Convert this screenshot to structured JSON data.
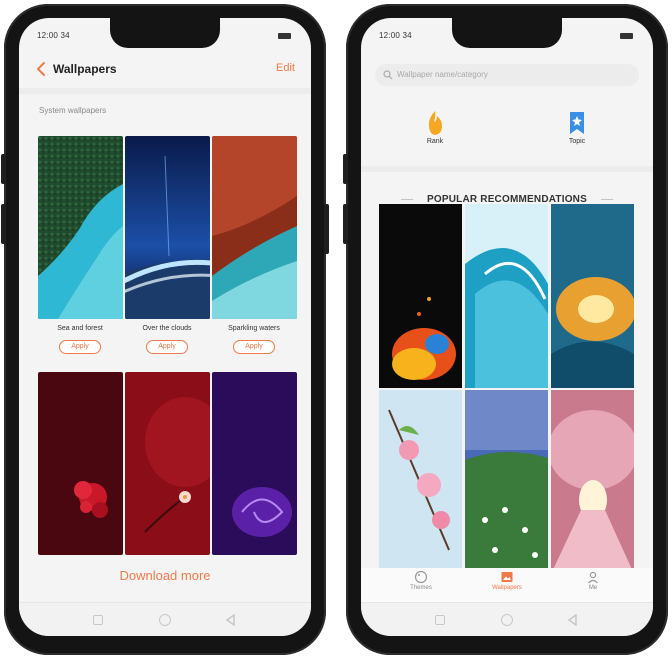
{
  "left_screen": {
    "status_time": "12:00 34",
    "title": "Wallpapers",
    "edit_label": "Edit",
    "section_label": "System wallpapers",
    "wallpapers": [
      {
        "name": "Sea and forest",
        "apply_label": "Apply"
      },
      {
        "name": "Over the clouds",
        "apply_label": "Apply"
      },
      {
        "name": "Sparkling waters",
        "apply_label": "Apply"
      }
    ],
    "download_more": "Download more"
  },
  "right_screen": {
    "status_time": "12:00 34",
    "search_placeholder": "Wallpaper name/category",
    "shortcuts": [
      {
        "label": "Rank",
        "icon": "flame-icon"
      },
      {
        "label": "Topic",
        "icon": "bookmark-icon"
      }
    ],
    "recommendations_title": "POPULAR RECOMMENDATIONS",
    "tabs": [
      {
        "label": "Themes",
        "icon": "palette-icon",
        "active": false
      },
      {
        "label": "Wallpapers",
        "icon": "picture-icon",
        "active": true
      },
      {
        "label": "Me",
        "icon": "person-icon",
        "active": false
      }
    ]
  },
  "colors": {
    "accent": "#f07a4a",
    "phone_body": "#141414",
    "screen_bg": "#f4f4f4"
  }
}
